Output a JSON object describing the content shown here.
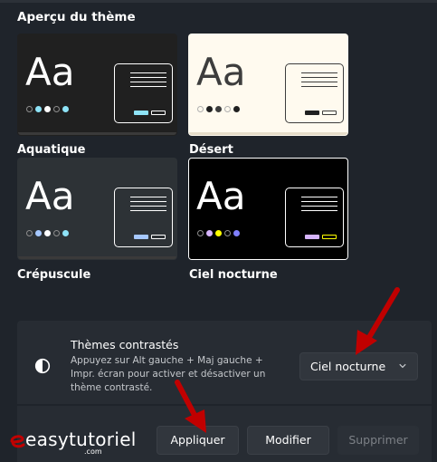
{
  "section_title": "Aperçu du thème",
  "themes": [
    {
      "label": "Aquatique",
      "preview_text": "Aa",
      "bg": "#202020",
      "fg": "#ffffff",
      "accent": "#8ee3f7",
      "dots": [
        "#8d8d8d",
        "#8ee3f7",
        "#ffffff",
        "#8d8d8d",
        "#8ee3f7"
      ],
      "selected": false
    },
    {
      "label": "Désert",
      "preview_text": "Aa",
      "bg": "#fffaef",
      "fg": "#3d3d3d",
      "accent": "#202020",
      "dots": [
        "#b0b0b0",
        "#202020",
        "#3d3d3d",
        "#b0b0b0",
        "#202020"
      ],
      "selected": false
    },
    {
      "label": "Crépuscule",
      "preview_text": "Aa",
      "bg": "#2d3236",
      "fg": "#ffffff",
      "accent": "#a6c8ff",
      "dots": [
        "#8d8d8d",
        "#a6c8ff",
        "#ffffff",
        "#8d8d8d",
        "#8ee3f7"
      ],
      "selected": false
    },
    {
      "label": "Ciel nocturne",
      "preview_text": "Aa",
      "bg": "#000000",
      "fg": "#ffffff",
      "accent": "#d6b4fd",
      "dots": [
        "#8d8d8d",
        "#d6b4fd",
        "#ffff00",
        "#8d8d8d",
        "#8080ff"
      ],
      "selected": true
    }
  ],
  "contrast": {
    "title": "Thèmes contrastés",
    "description": "Appuyez sur Alt gauche + Maj gauche + Impr. écran pour activer et désactiver un thème contrasté.",
    "selected_theme": "Ciel nocturne"
  },
  "buttons": {
    "apply": "Appliquer",
    "modify": "Modifier",
    "delete": "Supprimer"
  },
  "watermark": {
    "brand": "easytutoriel",
    "sub": ".com"
  },
  "colors": {
    "annotation_arrow": "#c00000",
    "background": "#1f242b",
    "panel": "#272c33"
  }
}
